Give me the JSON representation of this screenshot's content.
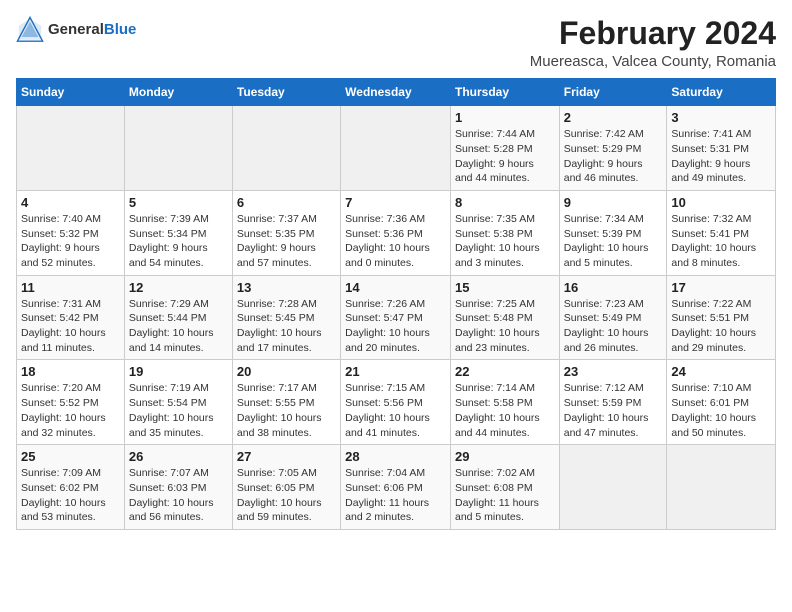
{
  "header": {
    "logo_general": "General",
    "logo_blue": "Blue",
    "month_year": "February 2024",
    "location": "Muereasca, Valcea County, Romania"
  },
  "calendar": {
    "days_of_week": [
      "Sunday",
      "Monday",
      "Tuesday",
      "Wednesday",
      "Thursday",
      "Friday",
      "Saturday"
    ],
    "weeks": [
      [
        {
          "day": "",
          "info": ""
        },
        {
          "day": "",
          "info": ""
        },
        {
          "day": "",
          "info": ""
        },
        {
          "day": "",
          "info": ""
        },
        {
          "day": "1",
          "info": "Sunrise: 7:44 AM\nSunset: 5:28 PM\nDaylight: 9 hours\nand 44 minutes."
        },
        {
          "day": "2",
          "info": "Sunrise: 7:42 AM\nSunset: 5:29 PM\nDaylight: 9 hours\nand 46 minutes."
        },
        {
          "day": "3",
          "info": "Sunrise: 7:41 AM\nSunset: 5:31 PM\nDaylight: 9 hours\nand 49 minutes."
        }
      ],
      [
        {
          "day": "4",
          "info": "Sunrise: 7:40 AM\nSunset: 5:32 PM\nDaylight: 9 hours\nand 52 minutes."
        },
        {
          "day": "5",
          "info": "Sunrise: 7:39 AM\nSunset: 5:34 PM\nDaylight: 9 hours\nand 54 minutes."
        },
        {
          "day": "6",
          "info": "Sunrise: 7:37 AM\nSunset: 5:35 PM\nDaylight: 9 hours\nand 57 minutes."
        },
        {
          "day": "7",
          "info": "Sunrise: 7:36 AM\nSunset: 5:36 PM\nDaylight: 10 hours\nand 0 minutes."
        },
        {
          "day": "8",
          "info": "Sunrise: 7:35 AM\nSunset: 5:38 PM\nDaylight: 10 hours\nand 3 minutes."
        },
        {
          "day": "9",
          "info": "Sunrise: 7:34 AM\nSunset: 5:39 PM\nDaylight: 10 hours\nand 5 minutes."
        },
        {
          "day": "10",
          "info": "Sunrise: 7:32 AM\nSunset: 5:41 PM\nDaylight: 10 hours\nand 8 minutes."
        }
      ],
      [
        {
          "day": "11",
          "info": "Sunrise: 7:31 AM\nSunset: 5:42 PM\nDaylight: 10 hours\nand 11 minutes."
        },
        {
          "day": "12",
          "info": "Sunrise: 7:29 AM\nSunset: 5:44 PM\nDaylight: 10 hours\nand 14 minutes."
        },
        {
          "day": "13",
          "info": "Sunrise: 7:28 AM\nSunset: 5:45 PM\nDaylight: 10 hours\nand 17 minutes."
        },
        {
          "day": "14",
          "info": "Sunrise: 7:26 AM\nSunset: 5:47 PM\nDaylight: 10 hours\nand 20 minutes."
        },
        {
          "day": "15",
          "info": "Sunrise: 7:25 AM\nSunset: 5:48 PM\nDaylight: 10 hours\nand 23 minutes."
        },
        {
          "day": "16",
          "info": "Sunrise: 7:23 AM\nSunset: 5:49 PM\nDaylight: 10 hours\nand 26 minutes."
        },
        {
          "day": "17",
          "info": "Sunrise: 7:22 AM\nSunset: 5:51 PM\nDaylight: 10 hours\nand 29 minutes."
        }
      ],
      [
        {
          "day": "18",
          "info": "Sunrise: 7:20 AM\nSunset: 5:52 PM\nDaylight: 10 hours\nand 32 minutes."
        },
        {
          "day": "19",
          "info": "Sunrise: 7:19 AM\nSunset: 5:54 PM\nDaylight: 10 hours\nand 35 minutes."
        },
        {
          "day": "20",
          "info": "Sunrise: 7:17 AM\nSunset: 5:55 PM\nDaylight: 10 hours\nand 38 minutes."
        },
        {
          "day": "21",
          "info": "Sunrise: 7:15 AM\nSunset: 5:56 PM\nDaylight: 10 hours\nand 41 minutes."
        },
        {
          "day": "22",
          "info": "Sunrise: 7:14 AM\nSunset: 5:58 PM\nDaylight: 10 hours\nand 44 minutes."
        },
        {
          "day": "23",
          "info": "Sunrise: 7:12 AM\nSunset: 5:59 PM\nDaylight: 10 hours\nand 47 minutes."
        },
        {
          "day": "24",
          "info": "Sunrise: 7:10 AM\nSunset: 6:01 PM\nDaylight: 10 hours\nand 50 minutes."
        }
      ],
      [
        {
          "day": "25",
          "info": "Sunrise: 7:09 AM\nSunset: 6:02 PM\nDaylight: 10 hours\nand 53 minutes."
        },
        {
          "day": "26",
          "info": "Sunrise: 7:07 AM\nSunset: 6:03 PM\nDaylight: 10 hours\nand 56 minutes."
        },
        {
          "day": "27",
          "info": "Sunrise: 7:05 AM\nSunset: 6:05 PM\nDaylight: 10 hours\nand 59 minutes."
        },
        {
          "day": "28",
          "info": "Sunrise: 7:04 AM\nSunset: 6:06 PM\nDaylight: 11 hours\nand 2 minutes."
        },
        {
          "day": "29",
          "info": "Sunrise: 7:02 AM\nSunset: 6:08 PM\nDaylight: 11 hours\nand 5 minutes."
        },
        {
          "day": "",
          "info": ""
        },
        {
          "day": "",
          "info": ""
        }
      ]
    ]
  }
}
